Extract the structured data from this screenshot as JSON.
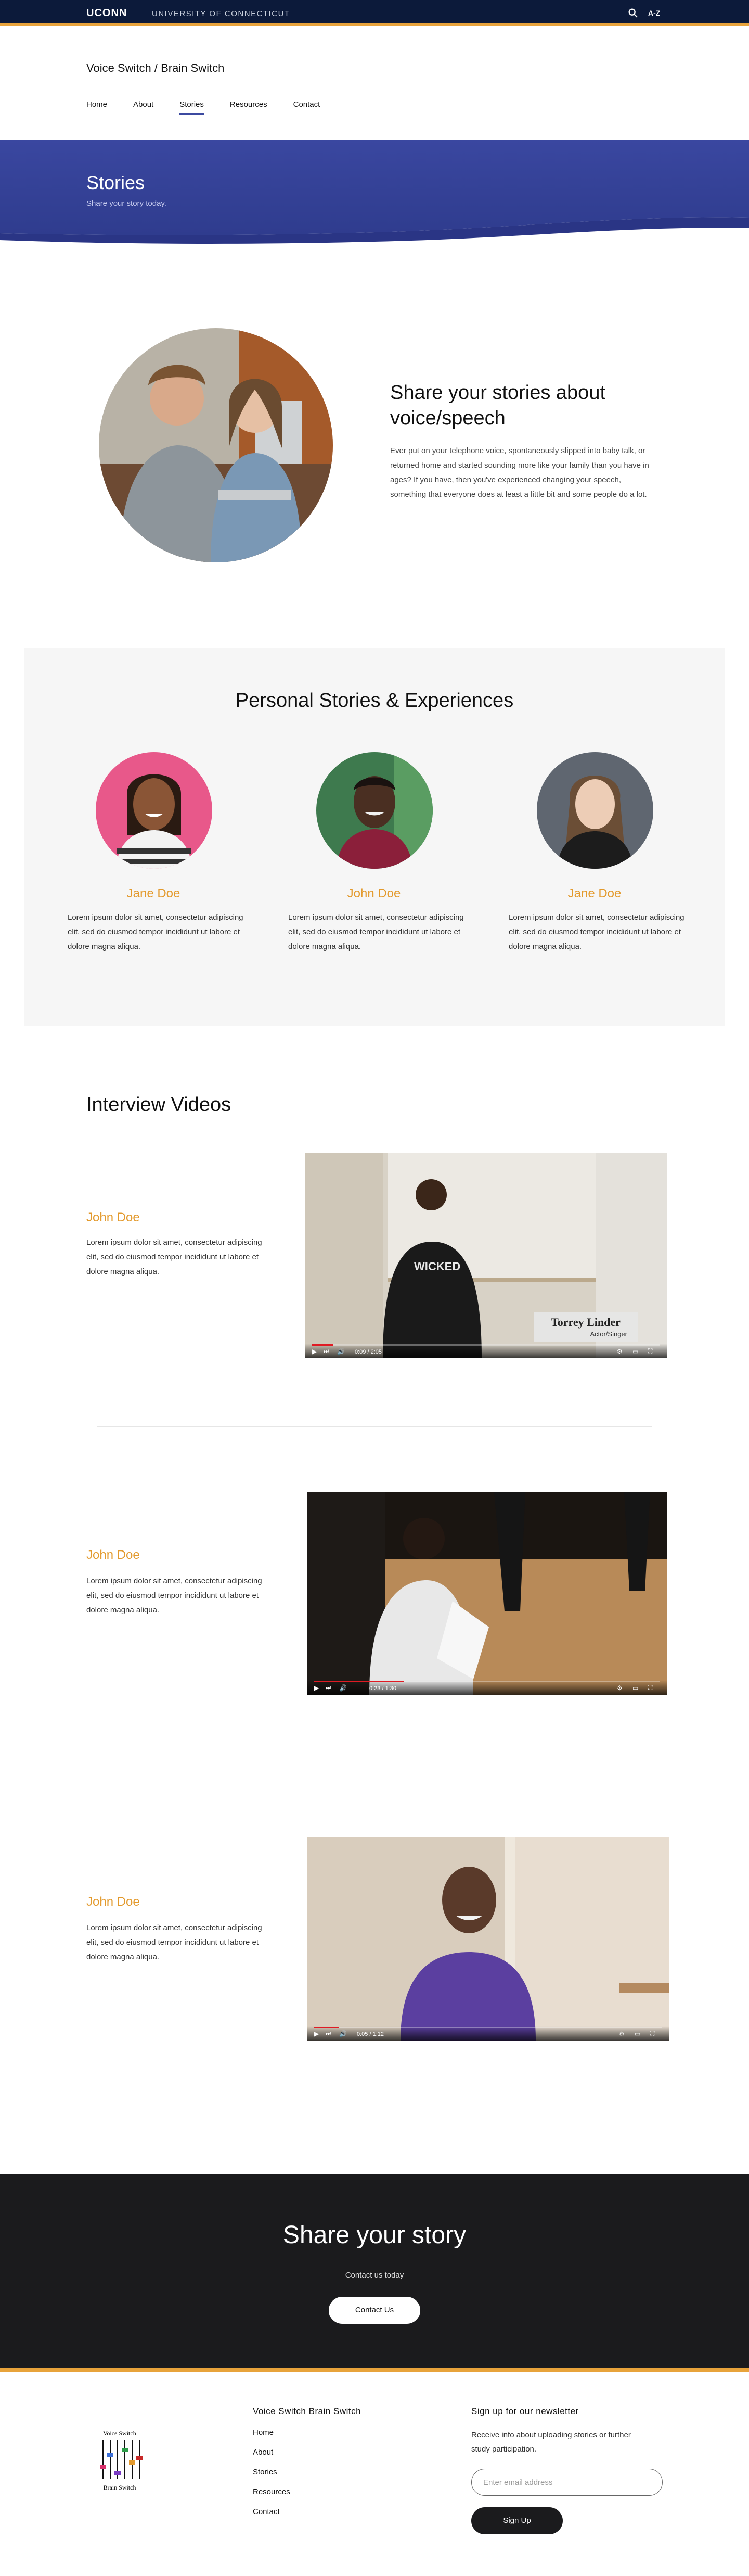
{
  "topbar": {
    "logo": "UCONN",
    "university": "UNIVERSITY OF CONNECTICUT",
    "search_icon": "search-icon",
    "az_label": "A-Z"
  },
  "site": {
    "title": "Voice Switch / Brain Switch"
  },
  "nav": {
    "items": [
      {
        "label": "Home"
      },
      {
        "label": "About"
      },
      {
        "label": "Stories"
      },
      {
        "label": "Resources"
      },
      {
        "label": "Contact"
      }
    ],
    "active": "Stories"
  },
  "hero": {
    "title": "Stories",
    "subtitle": "Share your story today."
  },
  "intro": {
    "title": "Share your stories about voice/speech",
    "text": "Ever put on your telephone voice, spontaneously slipped into baby talk, or returned home and started sounding more like your family than you have in ages?  If you have, then you've experienced changing your speech, something that everyone does at least a little bit and some people do a lot."
  },
  "stories": {
    "title": "Personal Stories & Experiences",
    "people": [
      {
        "name": "Jane Doe",
        "text": "Lorem ipsum dolor sit amet, consectetur adipiscing elit, sed do eiusmod tempor incididunt ut labore et dolore magna aliqua."
      },
      {
        "name": "John Doe",
        "text": "Lorem ipsum dolor sit amet, consectetur adipiscing elit, sed do eiusmod tempor incididunt ut labore et dolore magna aliqua."
      },
      {
        "name": "Jane Doe",
        "text": "Lorem ipsum dolor sit amet, consectetur adipiscing elit, sed do eiusmod tempor incididunt ut labore et dolore magna aliqua."
      }
    ]
  },
  "videos": {
    "title": "Interview Videos",
    "items": [
      {
        "name": "John Doe",
        "text": "Lorem ipsum dolor sit amet, consectetur adipiscing elit, sed do eiusmod tempor incididunt ut labore et dolore magna aliqua.",
        "caption_name": "Torrey Linder",
        "caption_role": "Actor/Singer",
        "time": "0:09 / 2:05",
        "progress": 0.06
      },
      {
        "name": "John Doe",
        "text": "Lorem ipsum dolor sit amet, consectetur adipiscing elit, sed do eiusmod tempor incididunt ut labore et dolore magna aliqua.",
        "time": "0:23 / 1:30",
        "progress": 0.26
      },
      {
        "name": "John Doe",
        "text": "Lorem ipsum dolor sit amet, consectetur adipiscing elit, sed do eiusmod tempor incididunt ut labore et dolore magna aliqua.",
        "time": "0:05 / 1:12",
        "progress": 0.07
      }
    ]
  },
  "cta": {
    "title": "Share your story",
    "subtitle": "Contact us today",
    "button": "Contact Us"
  },
  "footer": {
    "logo_text_top": "Voice Switch",
    "logo_text_bottom": "Brain Switch",
    "site_title": "Voice Switch Brain Switch",
    "links": [
      "Home",
      "About",
      "Stories",
      "Resources",
      "Contact"
    ],
    "newsletter_title": "Sign up for our newsletter",
    "newsletter_text": "Receive info about uploading stories or further study participation.",
    "email_placeholder": "Enter email address",
    "signup_button": "Sign Up"
  },
  "colors": {
    "navy": "#0c1a3a",
    "gold": "#e8a33b",
    "hero_blue": "#3c4aa0",
    "name_orange": "#e39a2d",
    "dark": "#1b1b1d"
  }
}
